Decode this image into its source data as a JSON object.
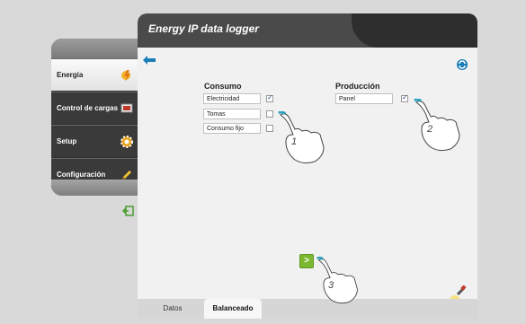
{
  "window": {
    "title": "Energy IP data logger"
  },
  "sidebar": {
    "items": [
      {
        "label": "Energia",
        "icon": "energy-icon",
        "active": true
      },
      {
        "label": "Control de cargas",
        "icon": "load-control-icon",
        "active": false
      },
      {
        "label": "Setup",
        "icon": "gear-icon",
        "active": false
      },
      {
        "label": "Configuración",
        "icon": "pencil-icon",
        "active": false
      }
    ]
  },
  "consumo": {
    "title": "Consumo",
    "items": [
      {
        "value": "Electricidad",
        "checked": true
      },
      {
        "value": "Tomas",
        "checked": false
      },
      {
        "value": "Consumo fijo",
        "checked": false
      }
    ]
  },
  "produccion": {
    "title": "Producción",
    "items": [
      {
        "value": "Panel",
        "checked": true
      }
    ]
  },
  "next_button": {
    "label": ">"
  },
  "tabs": [
    {
      "label": "Datos"
    },
    {
      "label": "Balanceado"
    }
  ],
  "callouts": {
    "one": "1",
    "two": "2",
    "three": "3"
  },
  "colors": {
    "accent": "#1a7fb8",
    "next": "#7cb82f",
    "callout": "#2aa3bf"
  }
}
